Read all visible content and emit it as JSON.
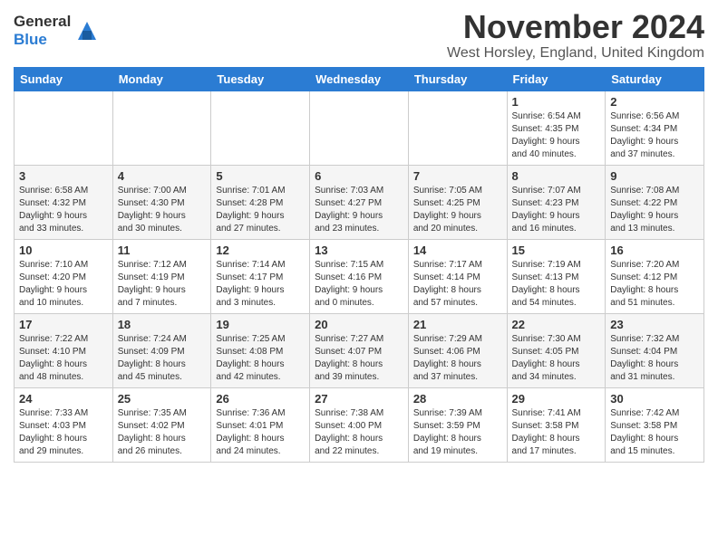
{
  "header": {
    "logo_line1": "General",
    "logo_line2": "Blue",
    "title": "November 2024",
    "location": "West Horsley, England, United Kingdom"
  },
  "columns": [
    "Sunday",
    "Monday",
    "Tuesday",
    "Wednesday",
    "Thursday",
    "Friday",
    "Saturday"
  ],
  "weeks": [
    [
      {
        "day": "",
        "info": ""
      },
      {
        "day": "",
        "info": ""
      },
      {
        "day": "",
        "info": ""
      },
      {
        "day": "",
        "info": ""
      },
      {
        "day": "",
        "info": ""
      },
      {
        "day": "1",
        "info": "Sunrise: 6:54 AM\nSunset: 4:35 PM\nDaylight: 9 hours\nand 40 minutes."
      },
      {
        "day": "2",
        "info": "Sunrise: 6:56 AM\nSunset: 4:34 PM\nDaylight: 9 hours\nand 37 minutes."
      }
    ],
    [
      {
        "day": "3",
        "info": "Sunrise: 6:58 AM\nSunset: 4:32 PM\nDaylight: 9 hours\nand 33 minutes."
      },
      {
        "day": "4",
        "info": "Sunrise: 7:00 AM\nSunset: 4:30 PM\nDaylight: 9 hours\nand 30 minutes."
      },
      {
        "day": "5",
        "info": "Sunrise: 7:01 AM\nSunset: 4:28 PM\nDaylight: 9 hours\nand 27 minutes."
      },
      {
        "day": "6",
        "info": "Sunrise: 7:03 AM\nSunset: 4:27 PM\nDaylight: 9 hours\nand 23 minutes."
      },
      {
        "day": "7",
        "info": "Sunrise: 7:05 AM\nSunset: 4:25 PM\nDaylight: 9 hours\nand 20 minutes."
      },
      {
        "day": "8",
        "info": "Sunrise: 7:07 AM\nSunset: 4:23 PM\nDaylight: 9 hours\nand 16 minutes."
      },
      {
        "day": "9",
        "info": "Sunrise: 7:08 AM\nSunset: 4:22 PM\nDaylight: 9 hours\nand 13 minutes."
      }
    ],
    [
      {
        "day": "10",
        "info": "Sunrise: 7:10 AM\nSunset: 4:20 PM\nDaylight: 9 hours\nand 10 minutes."
      },
      {
        "day": "11",
        "info": "Sunrise: 7:12 AM\nSunset: 4:19 PM\nDaylight: 9 hours\nand 7 minutes."
      },
      {
        "day": "12",
        "info": "Sunrise: 7:14 AM\nSunset: 4:17 PM\nDaylight: 9 hours\nand 3 minutes."
      },
      {
        "day": "13",
        "info": "Sunrise: 7:15 AM\nSunset: 4:16 PM\nDaylight: 9 hours\nand 0 minutes."
      },
      {
        "day": "14",
        "info": "Sunrise: 7:17 AM\nSunset: 4:14 PM\nDaylight: 8 hours\nand 57 minutes."
      },
      {
        "day": "15",
        "info": "Sunrise: 7:19 AM\nSunset: 4:13 PM\nDaylight: 8 hours\nand 54 minutes."
      },
      {
        "day": "16",
        "info": "Sunrise: 7:20 AM\nSunset: 4:12 PM\nDaylight: 8 hours\nand 51 minutes."
      }
    ],
    [
      {
        "day": "17",
        "info": "Sunrise: 7:22 AM\nSunset: 4:10 PM\nDaylight: 8 hours\nand 48 minutes."
      },
      {
        "day": "18",
        "info": "Sunrise: 7:24 AM\nSunset: 4:09 PM\nDaylight: 8 hours\nand 45 minutes."
      },
      {
        "day": "19",
        "info": "Sunrise: 7:25 AM\nSunset: 4:08 PM\nDaylight: 8 hours\nand 42 minutes."
      },
      {
        "day": "20",
        "info": "Sunrise: 7:27 AM\nSunset: 4:07 PM\nDaylight: 8 hours\nand 39 minutes."
      },
      {
        "day": "21",
        "info": "Sunrise: 7:29 AM\nSunset: 4:06 PM\nDaylight: 8 hours\nand 37 minutes."
      },
      {
        "day": "22",
        "info": "Sunrise: 7:30 AM\nSunset: 4:05 PM\nDaylight: 8 hours\nand 34 minutes."
      },
      {
        "day": "23",
        "info": "Sunrise: 7:32 AM\nSunset: 4:04 PM\nDaylight: 8 hours\nand 31 minutes."
      }
    ],
    [
      {
        "day": "24",
        "info": "Sunrise: 7:33 AM\nSunset: 4:03 PM\nDaylight: 8 hours\nand 29 minutes."
      },
      {
        "day": "25",
        "info": "Sunrise: 7:35 AM\nSunset: 4:02 PM\nDaylight: 8 hours\nand 26 minutes."
      },
      {
        "day": "26",
        "info": "Sunrise: 7:36 AM\nSunset: 4:01 PM\nDaylight: 8 hours\nand 24 minutes."
      },
      {
        "day": "27",
        "info": "Sunrise: 7:38 AM\nSunset: 4:00 PM\nDaylight: 8 hours\nand 22 minutes."
      },
      {
        "day": "28",
        "info": "Sunrise: 7:39 AM\nSunset: 3:59 PM\nDaylight: 8 hours\nand 19 minutes."
      },
      {
        "day": "29",
        "info": "Sunrise: 7:41 AM\nSunset: 3:58 PM\nDaylight: 8 hours\nand 17 minutes."
      },
      {
        "day": "30",
        "info": "Sunrise: 7:42 AM\nSunset: 3:58 PM\nDaylight: 8 hours\nand 15 minutes."
      }
    ]
  ]
}
